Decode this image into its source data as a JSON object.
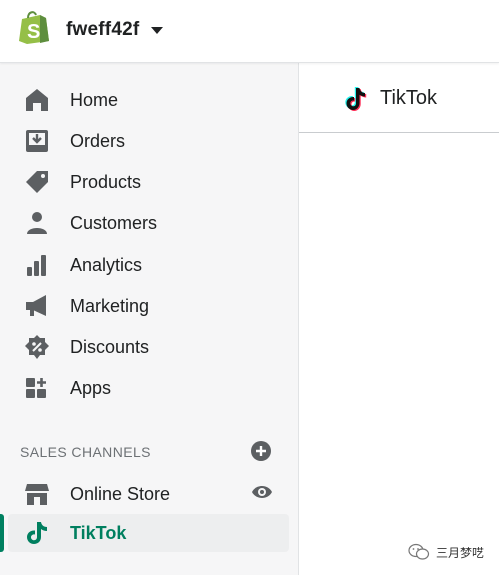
{
  "header": {
    "store_name": "fweff42f",
    "logo_icon": "shopify-bag-icon",
    "switcher_icon": "caret-down-icon"
  },
  "sidebar": {
    "items": [
      {
        "label": "Home",
        "icon": "home-icon"
      },
      {
        "label": "Orders",
        "icon": "orders-icon"
      },
      {
        "label": "Products",
        "icon": "tag-icon"
      },
      {
        "label": "Customers",
        "icon": "person-icon"
      },
      {
        "label": "Analytics",
        "icon": "bar-chart-icon"
      },
      {
        "label": "Marketing",
        "icon": "megaphone-icon"
      },
      {
        "label": "Discounts",
        "icon": "discount-badge-icon"
      },
      {
        "label": "Apps",
        "icon": "apps-grid-icon"
      }
    ],
    "sales_channels": {
      "title": "SALES CHANNELS",
      "add_icon": "plus-circle-icon",
      "channels": [
        {
          "label": "Online Store",
          "icon": "storefront-icon",
          "action_icon": "eye-icon"
        },
        {
          "label": "TikTok",
          "icon": "tiktok-icon",
          "active": true
        }
      ]
    }
  },
  "main": {
    "title": "TikTok",
    "title_icon": "tiktok-icon"
  },
  "watermark": {
    "text": "三月梦呓",
    "icon": "wechat-icon"
  },
  "colors": {
    "brand_green": "#95bf47",
    "active_green": "#007f5f",
    "icon_gray": "#5c5f62",
    "sidebar_bg": "#f6f6f7"
  }
}
